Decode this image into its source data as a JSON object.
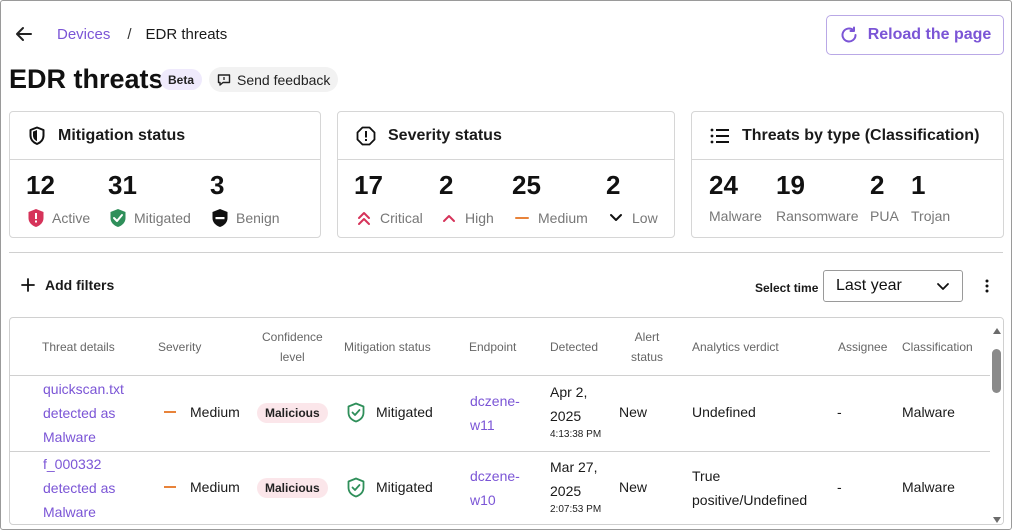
{
  "breadcrumb": {
    "parent": "Devices",
    "separator": "/",
    "current": "EDR threats"
  },
  "header": {
    "reload_label": "Reload the page",
    "title": "EDR threats",
    "beta": "Beta",
    "feedback": "Send feedback"
  },
  "cards": {
    "mitigation": {
      "title": "Mitigation status",
      "stats": [
        {
          "value": "12",
          "label": "Active",
          "icon": "shield-alert-icon",
          "color": "#d6335a"
        },
        {
          "value": "31",
          "label": "Mitigated",
          "icon": "shield-check-icon",
          "color": "#2f8f5a"
        },
        {
          "value": "3",
          "label": "Benign",
          "icon": "shield-minus-icon",
          "color": "#111111"
        }
      ]
    },
    "severity": {
      "title": "Severity status",
      "stats": [
        {
          "value": "17",
          "label": "Critical",
          "icon": "double-chevron-up-icon",
          "color": "#d6335a"
        },
        {
          "value": "2",
          "label": "High",
          "icon": "chevron-up-icon",
          "color": "#d6335a"
        },
        {
          "value": "25",
          "label": "Medium",
          "icon": "dash-icon",
          "color": "#e8833a"
        },
        {
          "value": "2",
          "label": "Low",
          "icon": "chevron-down-icon",
          "color": "#111111"
        }
      ]
    },
    "threats": {
      "title": "Threats by type (Classification)",
      "stats": [
        {
          "value": "24",
          "label": "Malware"
        },
        {
          "value": "19",
          "label": "Ransomware"
        },
        {
          "value": "2",
          "label": "PUA"
        },
        {
          "value": "1",
          "label": "Trojan"
        }
      ]
    }
  },
  "filters": {
    "add_label": "Add filters",
    "select_time_label": "Select time",
    "time_value": "Last year"
  },
  "table": {
    "headers": {
      "threat_details": "Threat details",
      "severity": "Severity",
      "confidence_1": "Confidence",
      "confidence_2": "level",
      "mitigation": "Mitigation status",
      "endpoint": "Endpoint",
      "detected": "Detected",
      "alert_1": "Alert",
      "alert_2": "status",
      "verdict": "Analytics verdict",
      "assignee": "Assignee",
      "classification": "Classification"
    },
    "rows": [
      {
        "threat_1": "quickscan.txt",
        "threat_2": "detected as",
        "threat_3": "Malware",
        "severity": "Medium",
        "confidence": "Malicious",
        "mitigation": "Mitigated",
        "endpoint_1": "dczene-",
        "endpoint_2": "w11",
        "detected_1": "Apr 2,",
        "detected_2": "2025",
        "detected_time": "4:13:38 PM",
        "alert": "New",
        "verdict_1": "Undefined",
        "verdict_2": "",
        "assignee": "-",
        "classification": "Malware"
      },
      {
        "threat_1": "f_000332",
        "threat_2": "detected as",
        "threat_3": "Malware",
        "severity": "Medium",
        "confidence": "Malicious",
        "mitigation": "Mitigated",
        "endpoint_1": "dczene-",
        "endpoint_2": "w10",
        "detected_1": "Mar 27,",
        "detected_2": "2025",
        "detected_time": "2:07:53 PM",
        "alert": "New",
        "verdict_1": "True",
        "verdict_2": "positive/Undefined",
        "assignee": "-",
        "classification": "Malware"
      }
    ]
  },
  "colors": {
    "accent": "#7b55d6",
    "critical": "#d6335a",
    "medium": "#e8833a",
    "mitigated": "#2f8f5a"
  }
}
